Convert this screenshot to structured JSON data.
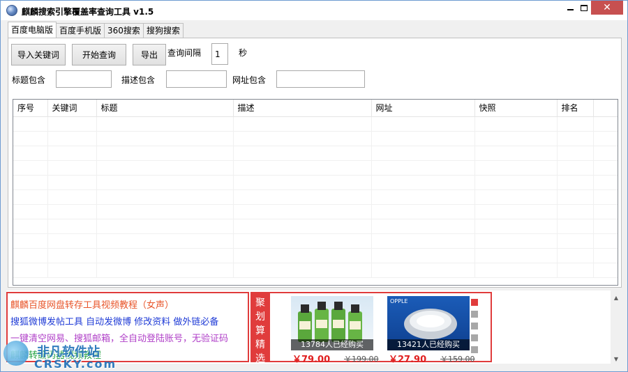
{
  "window": {
    "title": "麒麟搜索引擎覆盖率查询工具 v1.5",
    "minimize_icon": "minimize-icon",
    "maximize_icon": "maximize-icon",
    "close_icon": "close-icon",
    "close_label": "✕"
  },
  "tabs": [
    {
      "label": "百度电脑版",
      "active": true
    },
    {
      "label": "百度手机版",
      "active": false
    },
    {
      "label": "360搜索",
      "active": false
    },
    {
      "label": "搜狗搜索",
      "active": false
    }
  ],
  "toolbar": {
    "import_label": "导入关键词",
    "start_label": "开始查询",
    "export_label": "导出",
    "interval_label": "查询间隔",
    "interval_value": "1",
    "interval_unit": "秒"
  },
  "filters": {
    "title_contains_label": "标题包含",
    "title_contains_value": "",
    "desc_contains_label": "描述包含",
    "desc_contains_value": "",
    "url_contains_label": "网址包含",
    "url_contains_value": ""
  },
  "results_table": {
    "columns": [
      "序号",
      "关键词",
      "标题",
      "描述",
      "网址",
      "快照",
      "排名"
    ],
    "rows": []
  },
  "ad": {
    "links": [
      "麒麟百度网盘转存工具视频教程（女声）",
      "搜狐微博发帖工具  自动发微博  修改资料  做外链必备",
      "一键清空网易、搜狐邮箱，全自动登陆账号，无验证码",
      "麒麟转编码器视频教程"
    ],
    "vertical_label": "聚划算精选",
    "products": [
      {
        "bought": "13784人已经购买",
        "price": "￥79.00",
        "old_price": "￥199.00"
      },
      {
        "bought": "13421人已经购买",
        "price": "￥27.90",
        "old_price": "￥159.00"
      }
    ],
    "product2_brand": "OPPLE"
  },
  "watermark": {
    "line1": "非凡软件站",
    "line2": "CRSKY.com"
  },
  "colors": {
    "accent_red": "#e03c3c",
    "close_button": "#c75050",
    "link_blue": "#1f3bd6"
  }
}
